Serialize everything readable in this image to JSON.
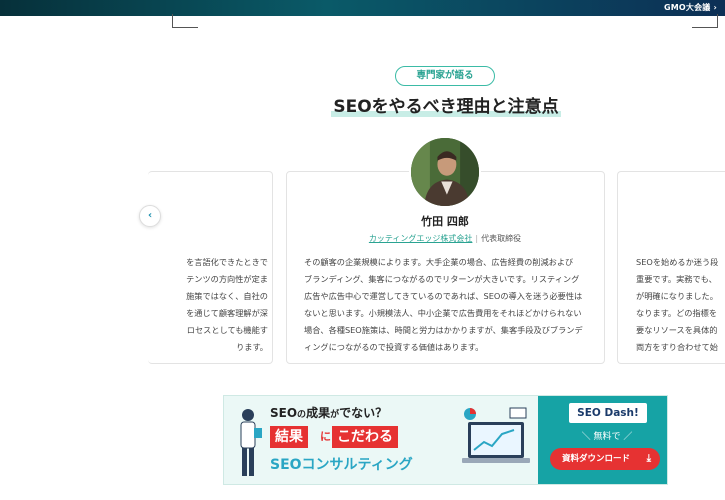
{
  "topbar": {
    "gmo_label": "GMO大会議 ›"
  },
  "section": {
    "pill_label": "専門家が語る",
    "heading": "SEOをやるべき理由と注意点"
  },
  "carousel": {
    "prev_label": "‹",
    "left_card": {
      "lines": [
        "を言語化できたときで",
        "テンツの方向性が定ま",
        "施策ではなく、自社の",
        "を通じて顧客理解が深",
        "ロセスとしても機能す",
        "ります。"
      ]
    },
    "center_card": {
      "name": "竹田 四郎",
      "company": "カッティングエッジ株式会社",
      "separator": "|",
      "role": "代表取締役",
      "lines": [
        "その顧客の企業規模によります。大手企業の場合、広告経費の削減および",
        "ブランディング、集客につながるのでリターンが大きいです。リスティング",
        "広告や広告中心で運営してきているのであれば、SEOの導入を迷う必要性は",
        "ないと思います。小規模法人、中小企業で広告費用をそれほどかけられない",
        "場合、各種SEO施策は、時間と労力はかかりますが、集客手段及びブランデ",
        "ィングにつながるので投資する価値はあります。"
      ]
    },
    "right_card": {
      "lines": [
        "SEOを始めるか迷う段",
        "重要です。実務でも、",
        "が明確になりました。",
        "なります。どの指標を",
        "要なリソースを具体的",
        "両方をすり合わせて始"
      ]
    }
  },
  "banner": {
    "question_main": "SEO",
    "question_no": "の",
    "question_rest": "成果",
    "question_ga": "が",
    "question_end": "でない？",
    "red1": "結果",
    "mid": "に",
    "red2": "こだわる",
    "sub": "SEOコンサルティング",
    "logo": "SEO Dash!",
    "free": "＼ 無料で ／",
    "download": "資料ダウンロード",
    "download_icon": "⤓"
  },
  "colors": {
    "accent_teal": "#2aa392",
    "banner_red": "#e63232",
    "banner_teal": "#16a3a5"
  }
}
